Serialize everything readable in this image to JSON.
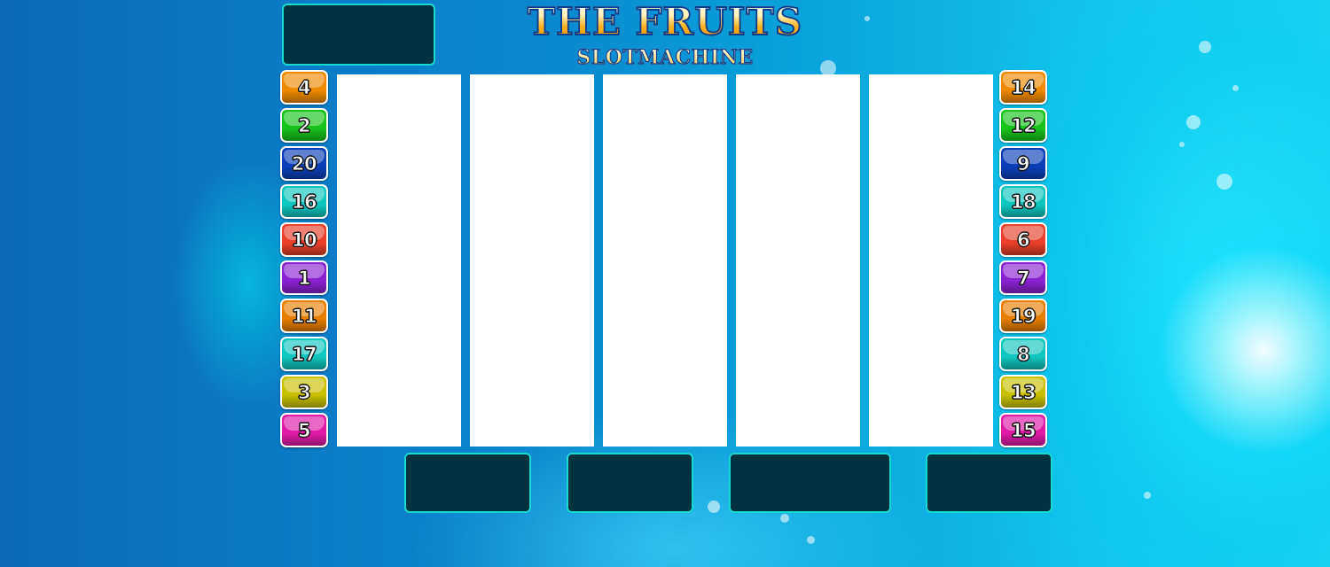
{
  "header": {
    "title": "THE FRUITS",
    "subtitle": "SLOTMACHINE"
  },
  "left_lines": [
    {
      "number": "4",
      "color": "#f08a00"
    },
    {
      "number": "2",
      "color": "#18c41c"
    },
    {
      "number": "20",
      "color": "#0a3fb8"
    },
    {
      "number": "16",
      "color": "#10c6c0"
    },
    {
      "number": "10",
      "color": "#e8402a"
    },
    {
      "number": "1",
      "color": "#8a22d2"
    },
    {
      "number": "11",
      "color": "#e67e00"
    },
    {
      "number": "17",
      "color": "#10c6c0"
    },
    {
      "number": "3",
      "color": "#c8c000"
    },
    {
      "number": "5",
      "color": "#e01aa8"
    }
  ],
  "right_lines": [
    {
      "number": "14",
      "color": "#f08a00"
    },
    {
      "number": "12",
      "color": "#18c41c"
    },
    {
      "number": "9",
      "color": "#0a3fb8"
    },
    {
      "number": "18",
      "color": "#10c6c0"
    },
    {
      "number": "6",
      "color": "#e8402a"
    },
    {
      "number": "7",
      "color": "#8a22d2"
    },
    {
      "number": "19",
      "color": "#e67e00"
    },
    {
      "number": "8",
      "color": "#10c6c0"
    },
    {
      "number": "13",
      "color": "#c8c000"
    },
    {
      "number": "15",
      "color": "#e01aa8"
    }
  ],
  "panel_colors": {
    "fill": "#003240",
    "border": "#17d9d0"
  },
  "reel_count": 5
}
